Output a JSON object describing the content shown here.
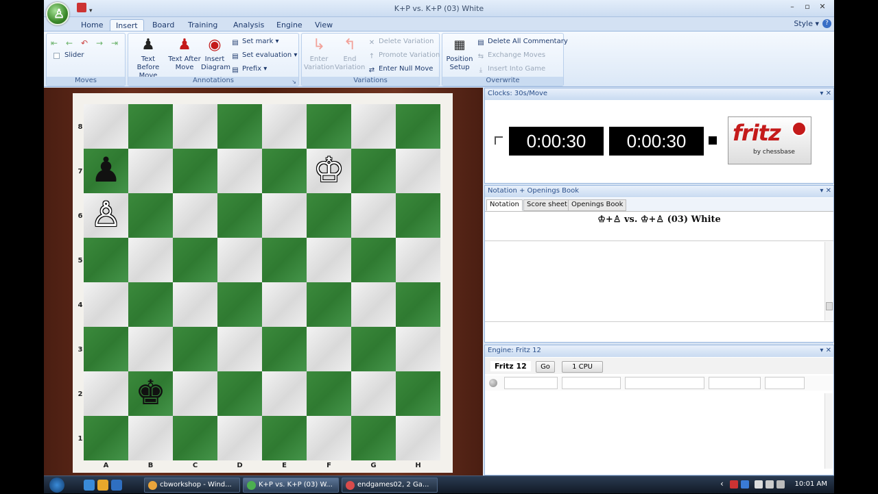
{
  "window": {
    "title": "K+P vs. K+P (03) White",
    "controls": [
      "–",
      "▫",
      "✕"
    ]
  },
  "quick_access": {
    "dropdown": "▾"
  },
  "app_menu": {
    "glyph": "♙"
  },
  "ribbon_tabs": [
    "Home",
    "Insert",
    "Board",
    "Training",
    "Analysis",
    "Engine",
    "View"
  ],
  "active_tab": "Insert",
  "style_menu": "Style ▾",
  "help": "?",
  "groups": {
    "moves": {
      "label": "Moves",
      "slider": "Slider",
      "arrows": [
        "⇤",
        "←",
        "↶",
        "→",
        "⇥"
      ]
    },
    "annotations": {
      "label": "Annotations",
      "text_before": [
        "Text Before",
        "Move"
      ],
      "text_after": [
        "Text After",
        "Move"
      ],
      "insert_diagram": [
        "Insert",
        "Diagram"
      ],
      "set_mark": "Set mark",
      "set_evaluation": "Set evaluation",
      "prefix": "Prefix",
      "launcher": "↘"
    },
    "variations": {
      "label": "Variations",
      "enter": [
        "Enter",
        "Variation"
      ],
      "end": [
        "End",
        "Variation"
      ],
      "delete": "Delete Variation",
      "promote": "Promote Variation",
      "null_move": "Enter Null Move"
    },
    "overwrite": {
      "label": "Overwrite",
      "position_setup": [
        "Position",
        "Setup"
      ],
      "delete_commentary": "Delete All Commentary",
      "exchange": "Exchange Moves",
      "insert_into_game": "Insert Into Game"
    }
  },
  "board": {
    "files": [
      "A",
      "B",
      "C",
      "D",
      "E",
      "F",
      "G",
      "H"
    ],
    "ranks": [
      "8",
      "7",
      "6",
      "5",
      "4",
      "3",
      "2",
      "1"
    ],
    "pieces": [
      {
        "square": "a7",
        "glyph": "♟",
        "color": "black",
        "name": "black-pawn-a7"
      },
      {
        "square": "a6",
        "glyph": "♙",
        "color": "white",
        "name": "white-pawn-a6"
      },
      {
        "square": "f7",
        "glyph": "♔",
        "color": "white",
        "name": "white-king-f7"
      },
      {
        "square": "b2",
        "glyph": "♚",
        "color": "black",
        "name": "black-king-b2"
      }
    ],
    "light_color": "#e6e6e6",
    "dark_color": "#3a8a3b"
  },
  "clocks": {
    "title": "Clocks: 30s/Move",
    "white_time": "0:00:30",
    "black_time": "0:00:30",
    "logo_text": "fritz",
    "logo_sub": "by chessbase"
  },
  "notation": {
    "title": "Notation + Openings Book",
    "tabs": [
      "Notation",
      "Score sheet",
      "Openings Book"
    ],
    "game_header": "♔+♙ vs. ♔+♙ (03) White"
  },
  "engine": {
    "title": "Engine: Fritz 12",
    "name": "Fritz 12",
    "go": "Go",
    "cpu": "1 CPU"
  },
  "panel_controls": "▾ ✕",
  "taskbar": {
    "tasks": [
      {
        "label": "cbworkshop - Wind...",
        "color": "#e9a43b"
      },
      {
        "label": "K+P vs. K+P (03) W...",
        "color": "#4caf50"
      },
      {
        "label": "endgames02,  2 Ga...",
        "color": "#d84b4b"
      }
    ],
    "active_task": 1,
    "tray_arrow": "‹",
    "time": "10:01 AM"
  }
}
